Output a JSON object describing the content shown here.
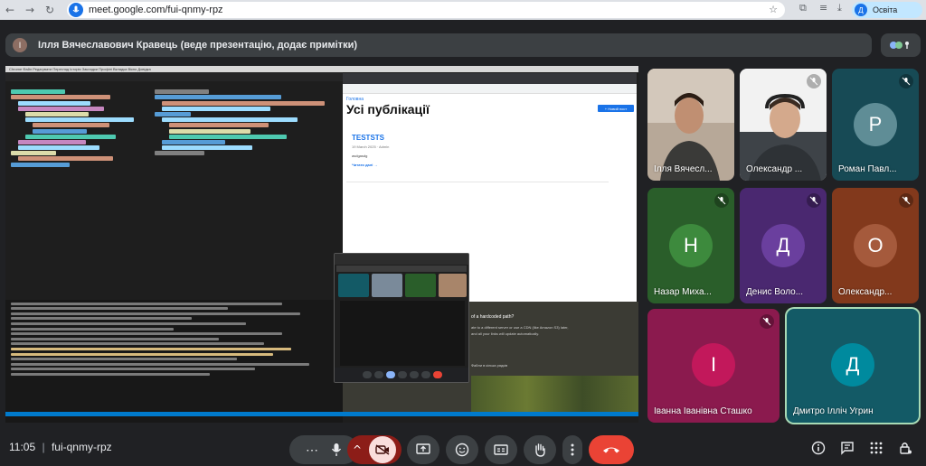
{
  "browser": {
    "url": "meet.google.com/fui-qnmy-rpz",
    "profile_label": "Освіта",
    "profile_initial": "Д"
  },
  "banner": {
    "initial": "І",
    "text": "Ілля Вячеславович Кравець (веде презентацію, додає примітки)"
  },
  "presentation": {
    "mac_menu": "Chrome  Файл  Редагувати  Перегляд  Історія  Закладки  Профілі  Вкладка  Вікно  Довідка",
    "page_link": "Головна",
    "page_title": "Усі публікації",
    "new_post_button": "+ Новий пост",
    "post_title": "TESTSTS",
    "post_meta": "19 March 2025 · Admin",
    "post_body": "asdgasdg",
    "read_more": "Читати далі →",
    "overlay_line1": "of a hardcoded path?",
    "overlay_line2": "ate to a different server or use a CDN (like Amazon S3) later,",
    "overlay_line3": "and all your links will update automatically.",
    "overlay_line4": "Файли в кілька рядків"
  },
  "participants": [
    {
      "name": "Ілля Вячесл...",
      "initial": "",
      "bg": "#a8856a",
      "video": true,
      "muted": false
    },
    {
      "name": "Олександр ...",
      "initial": "",
      "bg": "#4e5a60",
      "video": true,
      "muted": true
    },
    {
      "name": "Роман Павл...",
      "initial": "Р",
      "bg": "#174a55",
      "circle": "#5f8d96",
      "video": false,
      "muted": true
    },
    {
      "name": "Назар Миха...",
      "initial": "Н",
      "bg": "#2a5e2a",
      "circle": "#3d8a3d",
      "video": false,
      "muted": true
    },
    {
      "name": "Денис Воло...",
      "initial": "Д",
      "bg": "#4a2870",
      "circle": "#6a3f9e",
      "video": false,
      "muted": true
    },
    {
      "name": "Олександр...",
      "initial": "О",
      "bg": "#82391c",
      "circle": "#a55a3c",
      "video": false,
      "muted": true
    },
    {
      "name": "Іванна Іванівна Сташко",
      "initial": "І",
      "bg": "#8b1a4e",
      "circle": "#c2185b",
      "video": false,
      "muted": true
    },
    {
      "name": "Дмитро Ілліч Угрин",
      "initial": "Д",
      "bg": "#135a66",
      "circle": "#008a9e",
      "video": false,
      "muted": false,
      "selected": true
    }
  ],
  "bottom": {
    "time": "11:05",
    "separator": "|",
    "meeting_code": "fui-qnmy-rpz"
  }
}
